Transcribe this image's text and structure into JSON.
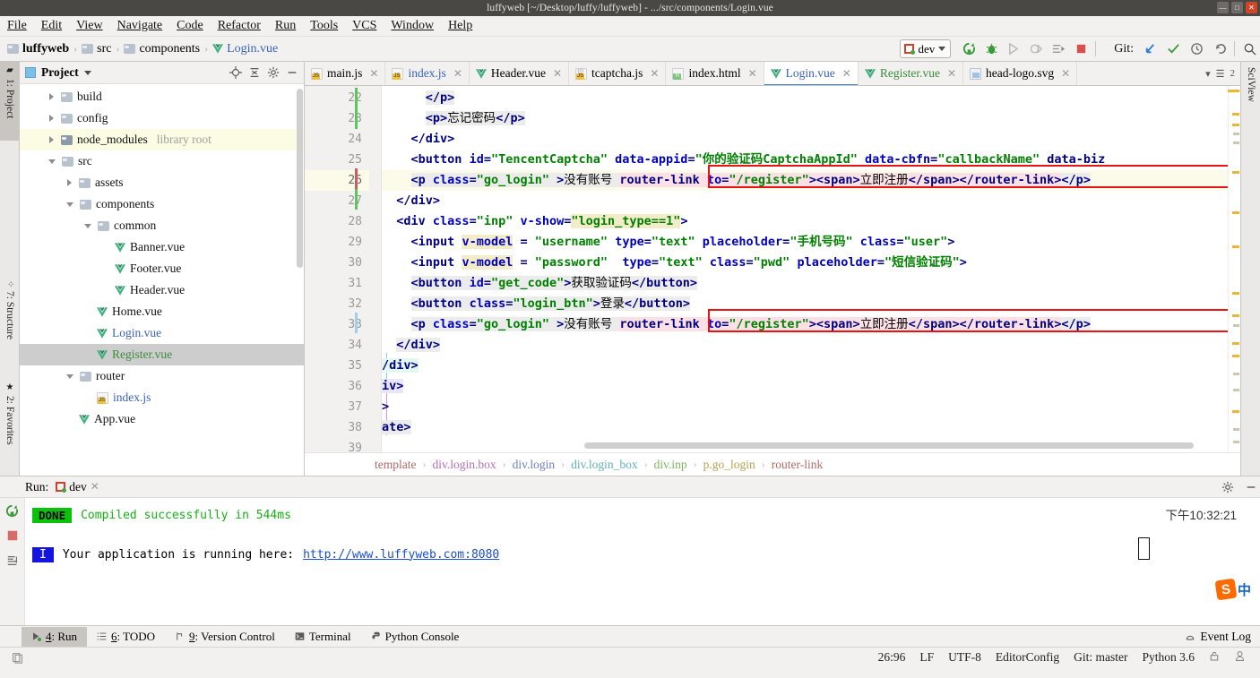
{
  "window": {
    "title": "luffyweb [~/Desktop/luffy/luffyweb] - .../src/components/Login.vue",
    "minimize": "—",
    "maximize": "□",
    "close": "✕"
  },
  "menubar": [
    {
      "label": "File"
    },
    {
      "label": "Edit"
    },
    {
      "label": "View"
    },
    {
      "label": "Navigate"
    },
    {
      "label": "Code"
    },
    {
      "label": "Refactor"
    },
    {
      "label": "Run"
    },
    {
      "label": "Tools"
    },
    {
      "label": "VCS"
    },
    {
      "label": "Window"
    },
    {
      "label": "Help"
    }
  ],
  "navbar": {
    "breadcrumbs": [
      {
        "label": "luffyweb",
        "icon": "folder-icon"
      },
      {
        "label": "src",
        "icon": "folder-icon"
      },
      {
        "label": "components",
        "icon": "folder-icon"
      },
      {
        "label": "Login.vue",
        "icon": "vue-icon"
      }
    ],
    "separator": "›",
    "run_config": "dev",
    "toolbar_icons": [
      "rerun-icon",
      "debug-icon",
      "run-icon",
      "debug-run-icon",
      "run-to-cursor-icon",
      "stop-icon"
    ],
    "git_label": "Git:",
    "git_icons": [
      "update-project-icon",
      "commit-icon",
      "history-icon",
      "rollback-icon"
    ],
    "search_icon": "search-icon"
  },
  "left_rail": [
    {
      "label": "1: Project",
      "selected": true
    },
    {
      "label": "7: Structure",
      "selected": false
    },
    {
      "label": "2: Favorites",
      "selected": false
    }
  ],
  "right_rail": [
    {
      "label": "SciView"
    }
  ],
  "project_panel": {
    "title": "Project",
    "header_icons": [
      "locate-icon",
      "collapse-all-icon",
      "gear-icon",
      "hide-icon"
    ],
    "tree": [
      {
        "label": "build",
        "indent": 1,
        "twist": "right",
        "icon": "folder-icon",
        "state": "normal"
      },
      {
        "label": "config",
        "indent": 1,
        "twist": "right",
        "icon": "folder-icon",
        "state": "normal"
      },
      {
        "label": "node_modules",
        "sublabel": "library root",
        "indent": 1,
        "twist": "right",
        "icon": "folder-dark-icon",
        "state": "highlight"
      },
      {
        "label": "src",
        "indent": 1,
        "twist": "down",
        "icon": "folder-icon",
        "state": "normal"
      },
      {
        "label": "assets",
        "indent": 2,
        "twist": "right",
        "icon": "folder-icon",
        "state": "normal"
      },
      {
        "label": "components",
        "indent": 2,
        "twist": "down",
        "icon": "folder-icon",
        "state": "normal"
      },
      {
        "label": "common",
        "indent": 3,
        "twist": "down",
        "icon": "folder-icon",
        "state": "normal"
      },
      {
        "label": "Banner.vue",
        "indent": 4,
        "twist": "none",
        "icon": "vue-icon",
        "state": "normal"
      },
      {
        "label": "Footer.vue",
        "indent": 4,
        "twist": "none",
        "icon": "vue-icon",
        "state": "normal"
      },
      {
        "label": "Header.vue",
        "indent": 4,
        "twist": "none",
        "icon": "vue-icon",
        "state": "normal"
      },
      {
        "label": "Home.vue",
        "indent": 3,
        "twist": "none",
        "icon": "vue-icon",
        "state": "normal"
      },
      {
        "label": "Login.vue",
        "indent": 3,
        "twist": "none",
        "icon": "vue-icon",
        "state": "blue"
      },
      {
        "label": "Register.vue",
        "indent": 3,
        "twist": "none",
        "icon": "vue-icon",
        "state": "selected"
      },
      {
        "label": "router",
        "indent": 2,
        "twist": "down",
        "icon": "folder-icon",
        "state": "normal"
      },
      {
        "label": "index.js",
        "indent": 3,
        "twist": "none",
        "icon": "js-icon",
        "state": "blue"
      },
      {
        "label": "App.vue",
        "indent": 2,
        "twist": "none",
        "icon": "vue-icon",
        "state": "normal"
      }
    ]
  },
  "editor_tabs": [
    {
      "label": "main.js",
      "icon": "js-icon",
      "active": false,
      "color": "normal"
    },
    {
      "label": "index.js",
      "icon": "js-icon",
      "active": false,
      "color": "blue"
    },
    {
      "label": "Header.vue",
      "icon": "vue-icon",
      "active": false,
      "color": "normal"
    },
    {
      "label": "tcaptcha.js",
      "icon": "js-annotated-icon",
      "active": false,
      "color": "normal"
    },
    {
      "label": "index.html",
      "icon": "html-icon",
      "active": false,
      "color": "normal"
    },
    {
      "label": "Login.vue",
      "icon": "vue-icon",
      "active": true,
      "color": "blue"
    },
    {
      "label": "Register.vue",
      "icon": "vue-icon",
      "active": false,
      "color": "green"
    },
    {
      "label": "head-logo.svg",
      "icon": "svg-icon",
      "active": false,
      "color": "normal"
    }
  ],
  "tab_overflow": "2",
  "code": {
    "first_line": 22,
    "lines": [
      {
        "n": 22,
        "current": false,
        "fold": true
      },
      {
        "n": 23,
        "current": false,
        "fold": false
      },
      {
        "n": 24,
        "current": false,
        "fold": true
      },
      {
        "n": 25,
        "current": false,
        "fold": false
      },
      {
        "n": 26,
        "current": true,
        "fold": false
      },
      {
        "n": 27,
        "current": false,
        "fold": true
      },
      {
        "n": 28,
        "current": false,
        "fold": true
      },
      {
        "n": 29,
        "current": false,
        "fold": false
      },
      {
        "n": 30,
        "current": false,
        "fold": false
      },
      {
        "n": 31,
        "current": false,
        "fold": false
      },
      {
        "n": 32,
        "current": false,
        "fold": false
      },
      {
        "n": 33,
        "current": false,
        "fold": false
      },
      {
        "n": 34,
        "current": false,
        "fold": true
      },
      {
        "n": 35,
        "current": false,
        "fold": true
      },
      {
        "n": 36,
        "current": false,
        "fold": true
      },
      {
        "n": 37,
        "current": false,
        "fold": true
      },
      {
        "n": 38,
        "current": false,
        "fold": true
      },
      {
        "n": 39,
        "current": false,
        "fold": false
      }
    ],
    "text": {
      "l22": "</p>",
      "l23": "<p>忘记密码</p>",
      "l24": "</div>",
      "l25": "<button id=\"TencentCaptcha\" data-appid=\"你的验证码CaptchaAppId\" data-cbfn=\"callbackName\" data-biz",
      "l26": "<p class=\"go_login\" >没有账号 <router-link to=\"/register\"><span>立即注册</span></router-link></p>",
      "l27": "</div>",
      "l28": "<div class=\"inp\" v-show=\"login_type==1\">",
      "l29": "<input v-model = \"username\" type=\"text\" placeholder=\"手机号码\" class=\"user\">",
      "l30": "<input v-model = \"password\"  type=\"text\" class=\"pwd\" placeholder=\"短信验证码\">",
      "l31": "<button id=\"get_code\">获取验证码</button>",
      "l32": "<button class=\"login_btn\">登录</button>",
      "l33": "<p class=\"go_login\" >没有账号 <router-link to=\"/register\"><span>立即注册</span></router-link></p>",
      "l34": "</div>",
      "l35": "/div>",
      "l36": "iv>",
      "l37": ">",
      "l38": "ate>",
      "l39": ""
    }
  },
  "editor_breadcrumb": [
    {
      "label": "template",
      "color": "#b06a6a"
    },
    {
      "label": "div.login.box",
      "color": "#b46fb4"
    },
    {
      "label": "div.login",
      "color": "#6f7fc4"
    },
    {
      "label": "div.login_box",
      "color": "#5fb0b8"
    },
    {
      "label": "div.inp",
      "color": "#7fb55f"
    },
    {
      "label": "p.go_login",
      "color": "#b5a14f"
    },
    {
      "label": "router-link",
      "color": "#b06a6a"
    }
  ],
  "run_panel": {
    "label": "Run:",
    "tab": "dev",
    "close": "✕",
    "status_badge": "DONE",
    "status_message": "Compiled successfully in 544ms",
    "info_badge": "I",
    "info_message": "Your application is running here:",
    "url": "http://www.luffyweb.com:8080",
    "timestamp": "下午10:32:21",
    "rail_icons": [
      "rerun-icon",
      "stop-icon",
      "scroll-to-end-icon"
    ],
    "settings_icon": "gear-icon",
    "hide_icon": "hide-icon"
  },
  "tool_window_bar": {
    "tabs": [
      {
        "label": "4: Run",
        "num": "4",
        "rest": ": Run",
        "icon": "run-icon",
        "selected": true
      },
      {
        "label": "6: TODO",
        "num": "6",
        "rest": ": TODO",
        "icon": "todo-icon",
        "selected": false
      },
      {
        "label": "9: Version Control",
        "num": "9",
        "rest": ": Version Control",
        "icon": "vcs-icon",
        "selected": false
      },
      {
        "label": "Terminal",
        "num": "",
        "rest": "Terminal",
        "icon": "terminal-icon",
        "selected": false
      },
      {
        "label": "Python Console",
        "num": "",
        "rest": "Python Console",
        "icon": "python-icon",
        "selected": false
      }
    ],
    "event_log": "Event Log",
    "event_log_icon": "event-log-icon"
  },
  "status_bar": {
    "caret_position": "26:96",
    "line_separator": "LF",
    "encoding": "UTF-8",
    "editor_config": "EditorConfig",
    "git_branch": "Git: master",
    "interpreter": "Python 3.6",
    "lock_icon": "lock-icon",
    "inspector_icon": "inspector-icon"
  },
  "ime": {
    "logo": "S",
    "label": "中"
  },
  "colors": {
    "accent_blue": "#4083c9",
    "tag": "#000080",
    "attribute": "#0000c0",
    "string": "#008000",
    "annotation_red": "#e81414",
    "done_green": "#0ac20a",
    "title_bg": "#4a4844"
  }
}
